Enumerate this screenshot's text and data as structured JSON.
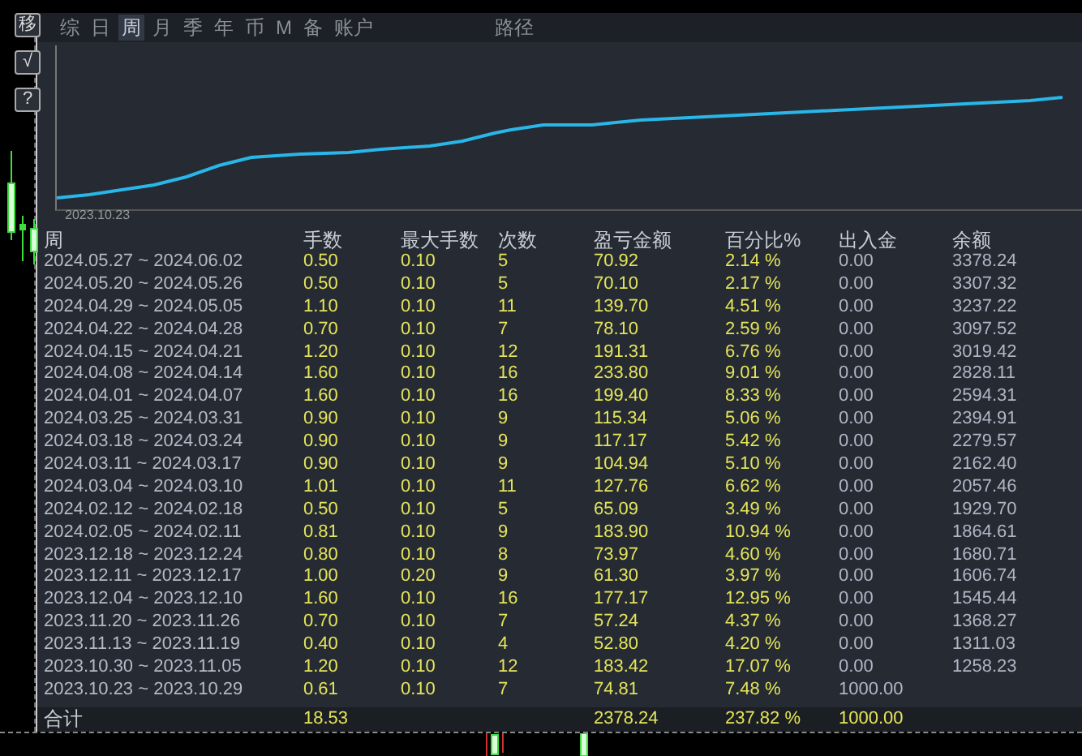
{
  "side_buttons": [
    "移",
    "√",
    "?"
  ],
  "tabs": [
    {
      "label": "综",
      "selected": false
    },
    {
      "label": "日",
      "selected": false
    },
    {
      "label": "周",
      "selected": true
    },
    {
      "label": "月",
      "selected": false
    },
    {
      "label": "季",
      "selected": false
    },
    {
      "label": "年",
      "selected": false
    },
    {
      "label": "币",
      "selected": false
    },
    {
      "label": "M",
      "selected": false
    },
    {
      "label": "备",
      "selected": false
    },
    {
      "label": "账户",
      "selected": false
    }
  ],
  "path_tab": {
    "label": "路径",
    "selected": false
  },
  "chart": {
    "x_start_label": "2023.10.23"
  },
  "table": {
    "columns": [
      "周",
      "手数",
      "最大手数",
      "次数",
      "盈亏金额",
      "百分比%",
      "出入金",
      "余额"
    ],
    "rows": [
      [
        "2024.05.27 ~ 2024.06.02",
        "0.50",
        "0.10",
        "5",
        "70.92",
        "2.14 %",
        "0.00",
        "3378.24"
      ],
      [
        "2024.05.20 ~ 2024.05.26",
        "0.50",
        "0.10",
        "5",
        "70.10",
        "2.17 %",
        "0.00",
        "3307.32"
      ],
      [
        "2024.04.29 ~ 2024.05.05",
        "1.10",
        "0.10",
        "11",
        "139.70",
        "4.51 %",
        "0.00",
        "3237.22"
      ],
      [
        "2024.04.22 ~ 2024.04.28",
        "0.70",
        "0.10",
        "7",
        "78.10",
        "2.59 %",
        "0.00",
        "3097.52"
      ],
      [
        "2024.04.15 ~ 2024.04.21",
        "1.20",
        "0.10",
        "12",
        "191.31",
        "6.76 %",
        "0.00",
        "3019.42"
      ],
      [
        "2024.04.08 ~ 2024.04.14",
        "1.60",
        "0.10",
        "16",
        "233.80",
        "9.01 %",
        "0.00",
        "2828.11"
      ],
      [
        "2024.04.01 ~ 2024.04.07",
        "1.60",
        "0.10",
        "16",
        "199.40",
        "8.33 %",
        "0.00",
        "2594.31"
      ],
      [
        "2024.03.25 ~ 2024.03.31",
        "0.90",
        "0.10",
        "9",
        "115.34",
        "5.06 %",
        "0.00",
        "2394.91"
      ],
      [
        "2024.03.18 ~ 2024.03.24",
        "0.90",
        "0.10",
        "9",
        "117.17",
        "5.42 %",
        "0.00",
        "2279.57"
      ],
      [
        "2024.03.11 ~ 2024.03.17",
        "0.90",
        "0.10",
        "9",
        "104.94",
        "5.10 %",
        "0.00",
        "2162.40"
      ],
      [
        "2024.03.04 ~ 2024.03.10",
        "1.01",
        "0.10",
        "11",
        "127.76",
        "6.62 %",
        "0.00",
        "2057.46"
      ],
      [
        "2024.02.12 ~ 2024.02.18",
        "0.50",
        "0.10",
        "5",
        "65.09",
        "3.49 %",
        "0.00",
        "1929.70"
      ],
      [
        "2024.02.05 ~ 2024.02.11",
        "0.81",
        "0.10",
        "9",
        "183.90",
        "10.94 %",
        "0.00",
        "1864.61"
      ],
      [
        "2023.12.18 ~ 2023.12.24",
        "0.80",
        "0.10",
        "8",
        "73.97",
        "4.60 %",
        "0.00",
        "1680.71"
      ],
      [
        "2023.12.11 ~ 2023.12.17",
        "1.00",
        "0.20",
        "9",
        "61.30",
        "3.97 %",
        "0.00",
        "1606.74"
      ],
      [
        "2023.12.04 ~ 2023.12.10",
        "1.60",
        "0.10",
        "16",
        "177.17",
        "12.95 %",
        "0.00",
        "1545.44"
      ],
      [
        "2023.11.20 ~ 2023.11.26",
        "0.70",
        "0.10",
        "7",
        "57.24",
        "4.37 %",
        "0.00",
        "1368.27"
      ],
      [
        "2023.11.13 ~ 2023.11.19",
        "0.40",
        "0.10",
        "4",
        "52.80",
        "4.20 %",
        "0.00",
        "1311.03"
      ],
      [
        "2023.10.30 ~ 2023.11.05",
        "1.20",
        "0.10",
        "12",
        "183.42",
        "17.07 %",
        "0.00",
        "1258.23"
      ],
      [
        "2023.10.23 ~ 2023.10.29",
        "0.61",
        "0.10",
        "7",
        "74.81",
        "7.48 %",
        "1000.00"
      ]
    ],
    "total": {
      "label": "合计",
      "lots": "18.53",
      "profit": "2378.24",
      "percent": "237.82 %",
      "deposit": "1000.00"
    }
  }
}
